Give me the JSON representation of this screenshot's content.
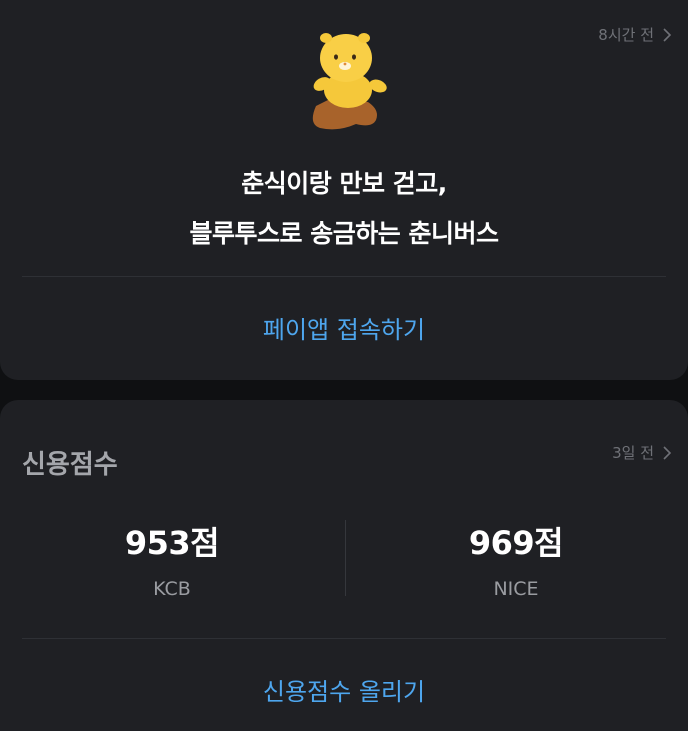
{
  "promo_card": {
    "timestamp": "8시간 전",
    "line1": "춘식이랑 만보 걷고,",
    "line2": "블루투스로 송금하는 춘니버스",
    "action_label": "페이앱 접속하기"
  },
  "credit_card": {
    "title": "신용점수",
    "timestamp": "3일 전",
    "scores": [
      {
        "value": "953점",
        "source": "KCB"
      },
      {
        "value": "969점",
        "source": "NICE"
      }
    ],
    "action_label": "신용점수 올리기"
  },
  "colors": {
    "background": "#0f1012",
    "card": "#1f2024",
    "accent": "#4ea6ee",
    "mascot": "#f5c83a"
  },
  "icons": {
    "chevron": "chevron-right-icon",
    "mascot": "choonsik-mascot"
  }
}
